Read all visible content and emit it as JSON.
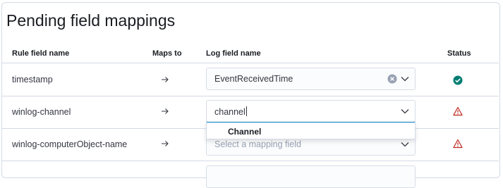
{
  "title": "Pending field mappings",
  "headers": {
    "rule_field": "Rule field name",
    "maps_to": "Maps to",
    "log_field": "Log field name",
    "status": "Status"
  },
  "rows": [
    {
      "rule_field": "timestamp",
      "log_value": "EventReceivedTime",
      "status": "mapped",
      "status_icon": "check-circle-icon"
    },
    {
      "rule_field": "winlog-channel",
      "log_value": "channel",
      "status": "warning",
      "status_icon": "warning-icon"
    },
    {
      "rule_field": "winlog-computerObject-name",
      "log_placeholder": "Select a mapping field",
      "status": "warning",
      "status_icon": "warning-icon"
    }
  ],
  "dropdown": {
    "options": [
      "Channel"
    ]
  },
  "colors": {
    "success": "#017d73",
    "danger": "#bd271e",
    "accent": "#0077cc"
  }
}
